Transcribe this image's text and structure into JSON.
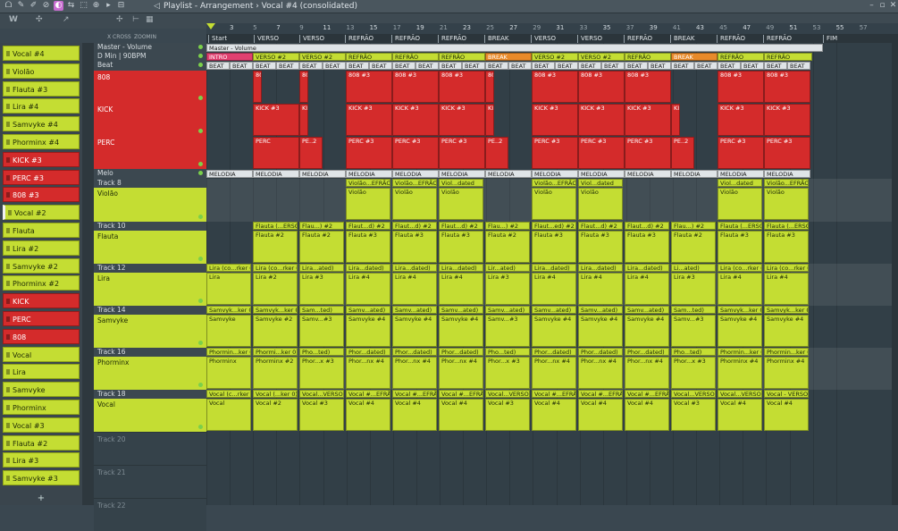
{
  "window": {
    "title": "Playlist - Arrangement › Vocal #4 (consolidated)"
  },
  "toolbar": {
    "icons": [
      "magnet-icon",
      "pencil-icon",
      "paint-icon",
      "delete-icon",
      "mute-icon",
      "slip-icon",
      "select-icon",
      "zoom-icon",
      "play-icon",
      "snap-icon"
    ],
    "window_buttons": [
      "minimize-icon",
      "maximize-icon",
      "close-icon"
    ]
  },
  "subbar": {
    "left_tools": [
      "piano-icon",
      "plug-icon",
      "scratch-icon"
    ],
    "x_cross": "X CROSS",
    "snap_label": "ZOOMIN"
  },
  "picker": [
    {
      "label": "Vocal #4",
      "color": "green"
    },
    {
      "label": "Violão",
      "color": "green"
    },
    {
      "label": "Flauta #3",
      "color": "green"
    },
    {
      "label": "Lira #4",
      "color": "green"
    },
    {
      "label": "Samvyke #4",
      "color": "green"
    },
    {
      "label": "Phorminx #4",
      "color": "green"
    },
    {
      "label": "KICK #3",
      "color": "red"
    },
    {
      "label": "PERC #3",
      "color": "red"
    },
    {
      "label": "808 #3",
      "color": "red"
    },
    {
      "label": "Vocal #2",
      "color": "green",
      "selected": true
    },
    {
      "label": "Flauta",
      "color": "green"
    },
    {
      "label": "Lira #2",
      "color": "green"
    },
    {
      "label": "Samvyke #2",
      "color": "green"
    },
    {
      "label": "Phorminx #2",
      "color": "green"
    },
    {
      "label": "KICK",
      "color": "red"
    },
    {
      "label": "PERC",
      "color": "red"
    },
    {
      "label": "808",
      "color": "red"
    },
    {
      "label": "Vocal",
      "color": "green"
    },
    {
      "label": "Lira",
      "color": "green"
    },
    {
      "label": "Samvyke",
      "color": "green"
    },
    {
      "label": "Phorminx",
      "color": "green"
    },
    {
      "label": "Vocal #3",
      "color": "green"
    },
    {
      "label": "Flauta #2",
      "color": "green"
    },
    {
      "label": "Lira #3",
      "color": "green"
    },
    {
      "label": "Samvyke #3",
      "color": "green"
    }
  ],
  "picker_add": "+",
  "ruler": [
    "3",
    "5",
    "7",
    "9",
    "11",
    "13",
    "15",
    "17",
    "19",
    "21",
    "23",
    "25",
    "27",
    "29",
    "31",
    "33",
    "35",
    "37",
    "39",
    "41",
    "43",
    "45",
    "47",
    "49",
    "51",
    "53",
    "55",
    "57"
  ],
  "markers": [
    "Start",
    "VERSO",
    "VERSO",
    "REFRÃO",
    "REFRÃO",
    "REFRÃO",
    "BREAK",
    "VERSO",
    "VERSO",
    "REFRÃO",
    "BREAK",
    "REFRÃO",
    "REFRÃO",
    "FIM"
  ],
  "tracks": {
    "master": "Master - Volume",
    "dmin": "D Min | 90BPM",
    "beat": "Beat",
    "r808": "808",
    "kick": "KICK",
    "perc": "PERC",
    "melo": "Melo",
    "t8": "Track 8",
    "violao": "Violão",
    "t10": "Track 10",
    "flauta": "Flauta",
    "t12": "Track 12",
    "lira": "Lira",
    "t14": "Track 14",
    "samvyke": "Samvyke",
    "t16": "Track 16",
    "phorminx": "Phorminx",
    "t18": "Track 18",
    "vocal": "Vocal",
    "t20": "Track 20",
    "t21": "Track 21",
    "t22": "Track 22"
  },
  "clips": {
    "master": "Master - Volume",
    "sections": [
      "INTRO",
      "VERSO #2",
      "VERSO #2",
      "REFRÃO",
      "REFRÃO",
      "REFRÃO",
      "BREAK",
      "VERSO #2",
      "VERSO #2",
      "REFRÃO",
      "BREAK",
      "REFRÃO",
      "REFRÃO"
    ],
    "beat": "BEAT",
    "r808": [
      "808 #3",
      "808 #3",
      "808 #3",
      "808 #3",
      "808 #3",
      "808 #3",
      "808 #3",
      "808 #3",
      "808 #3"
    ],
    "kick": [
      "KICK #3",
      "KICK #3",
      "KICK #3",
      "KICK #3",
      "KICK #3",
      "KICK #3",
      "KICK #3",
      "KICK #3"
    ],
    "perc": [
      "PERC",
      "PE..2",
      "PERC #3",
      "PERC #3",
      "PERC #3",
      "PE..2",
      "PERC #3",
      "PERC #3",
      "PERC #3",
      "PE..2",
      "PERC #3",
      "PERC #3"
    ],
    "melodia": "MELODIA",
    "violao_top": [
      "Violão...EFRÃO",
      "Violão...EFRÃO",
      "Viol...dated",
      "Violão...EFRÃO",
      "Violão...EFRÃO",
      "Viol...dated"
    ],
    "violao": [
      "Violão",
      "Violão",
      "Violão",
      "Violão",
      "Violão",
      "Violão",
      "Violão",
      "Violão"
    ],
    "flauta_top": [
      "Flauta (...ERSO",
      "Flau...) #2",
      "Flaut...d) #2",
      "Flaut...d) #2",
      "Flaut...d) #2",
      "Flau...) #2",
      "Flaut...ed) #2",
      "Flaut...d) #2",
      "Flaut...d) #2",
      "Flau...) #2",
      "Flauta (...ERSO",
      "Flauta (...ERSO"
    ],
    "flauta": [
      "Flauta #2",
      "Flauta #2",
      "Flauta #3",
      "Flauta #3",
      "Flauta #3",
      "Flauta #2",
      "Flauta #3",
      "Flauta #3",
      "Flauta #3",
      "Flauta #2",
      "Flauta #3",
      "Flauta #3"
    ],
    "lira_top": [
      "Lira (co...rker 0)",
      "Lira (co...rker 0)",
      "Lira...ated)",
      "Lira...dated)",
      "Lira...dated)",
      "Lira...dated)",
      "Lir...ated)",
      "Lira...dated)",
      "Lira...dated)",
      "Lira...dated)",
      "Li...ated)",
      "Lira (co...rker 0)",
      "Lira (co...rker 0)"
    ],
    "lira": [
      "Lira",
      "Lira #2",
      "Lira #3",
      "Lira #4",
      "Lira #4",
      "Lira #4",
      "Lira #3",
      "Lira #4",
      "Lira #4",
      "Lira #4",
      "Lira #3",
      "Lira #4",
      "Lira #4"
    ],
    "sam_top": [
      "Samvyk...ker 0)",
      "Samvyk...ker 0)",
      "Sam...ted)",
      "Samv...ated)",
      "Samv...ated)",
      "Samv...ated)",
      "Samv...ated)",
      "Samv...ated)",
      "Samv...ated)",
      "Samv...ated)",
      "Sam...ted)",
      "Samvyk...ker 0)",
      "Samvyk...ker 0)"
    ],
    "sam": [
      "Samvyke",
      "Samvyke #2",
      "Samv...#3",
      "Samvyke #4",
      "Samvyke #4",
      "Samvyke #4",
      "Samv...#3",
      "Samvyke #4",
      "Samvyke #4",
      "Samvyke #4",
      "Samv...#3",
      "Samvyke #4",
      "Samvyke #4"
    ],
    "pho_top": [
      "Phormin...ker 0)",
      "Phormi...ker 0)",
      "Pho...ted)",
      "Phor...dated)",
      "Phor...dated)",
      "Phor...dated)",
      "Pho...ted)",
      "Phor...dated)",
      "Phor...dated)",
      "Phor...dated)",
      "Pho...ted)",
      "Phormin...ker 0)",
      "Phormin...ker 0)"
    ],
    "pho": [
      "Phorminx",
      "Phorminx #2",
      "Phor...x #3",
      "Phor...nx #4",
      "Phor...nx #4",
      "Phor...nx #4",
      "Phor...x #3",
      "Phor...nx #4",
      "Phor...nx #4",
      "Phor...nx #4",
      "Phor...x #3",
      "Phorminx #4",
      "Phorminx #4"
    ],
    "voc_top": [
      "Vocal (c...rker 0)",
      "Vocal (...ker 0)",
      "Vocal...VERSO",
      "Vocal #...EFRÃO",
      "Vocal #...EFRÃO",
      "Vocal #...EFRÃO",
      "Vocal...VERSO",
      "Vocal #...EFRÃO",
      "Vocal #...EFRÃO",
      "Vocal #...EFRÃO",
      "Vocal...VERSO",
      "Vocal...VERSO",
      "Vocal - VERSO"
    ],
    "voc": [
      "Vocal",
      "Vocal #2",
      "Vocal #3",
      "Vocal #4",
      "Vocal #4",
      "Vocal #4",
      "Vocal #3",
      "Vocal #4",
      "Vocal #4",
      "Vocal #4",
      "Vocal #3",
      "Vocal #4",
      "Vocal #4"
    ]
  },
  "colors": {
    "red": "#d42b2b",
    "green": "#c4dd33",
    "bg": "#323f47"
  }
}
